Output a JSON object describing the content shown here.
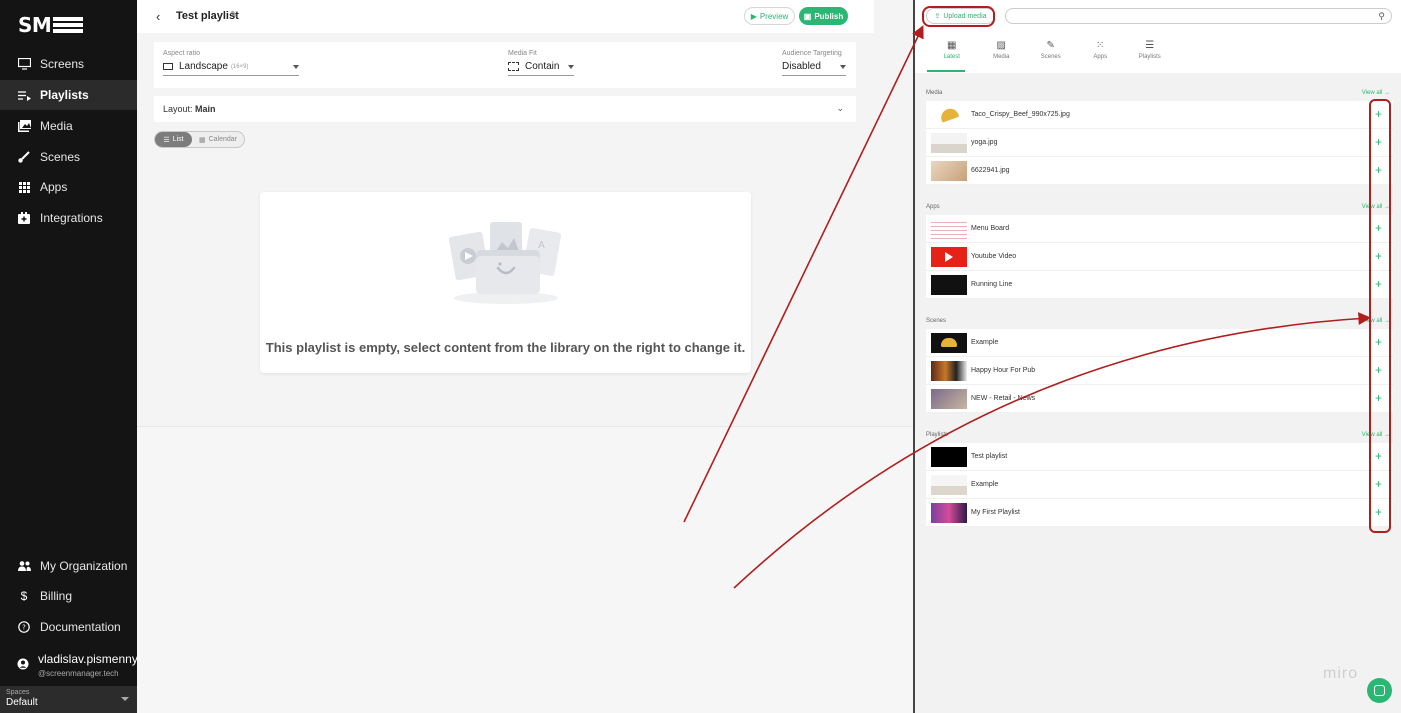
{
  "sidebar": {
    "logo": "SM",
    "items": [
      {
        "label": "Screens"
      },
      {
        "label": "Playlists"
      },
      {
        "label": "Media"
      },
      {
        "label": "Scenes"
      },
      {
        "label": "Apps"
      },
      {
        "label": "Integrations"
      }
    ],
    "bottom_items": [
      {
        "label": "My Organization"
      },
      {
        "label": "Billing"
      },
      {
        "label": "Documentation"
      }
    ],
    "user": {
      "name": "vladislav.pismennyj",
      "email": "@screenmanager.tech"
    },
    "spaces": {
      "label": "Spaces",
      "value": "Default"
    }
  },
  "header": {
    "back": "‹",
    "title": "Test playlist",
    "preview_label": "Preview",
    "publish_label": "Publish"
  },
  "settings": {
    "aspect": {
      "label": "Aspect ratio",
      "value": "Landscape",
      "sub": "(16×9)"
    },
    "fit": {
      "label": "Media Fit",
      "value": "Contain"
    },
    "targeting": {
      "label": "Audience Targeting",
      "value": "Disabled"
    }
  },
  "layout": {
    "prefix": "Layout:",
    "name": "Main"
  },
  "view_toggle": {
    "list": "List",
    "calendar": "Calendar"
  },
  "empty_message": "This playlist is empty, select content from the library on the right to change it.",
  "library": {
    "upload_label": "Upload media",
    "tabs": [
      "Latest",
      "Media",
      "Scenes",
      "Apps",
      "Playlists"
    ],
    "view_all": "View all",
    "sections": [
      {
        "title": "Media",
        "items": [
          "Taco_Crispy_Beef_990x725.jpg",
          "yoga.jpg",
          "6622941.jpg"
        ]
      },
      {
        "title": "Apps",
        "items": [
          "Menu Board",
          "Youtube Video",
          "Running Line"
        ]
      },
      {
        "title": "Scenes",
        "items": [
          "Example",
          "Happy Hour For Pub",
          "NEW - Retail - News"
        ]
      },
      {
        "title": "Playlists",
        "items": [
          "Test playlist",
          "Example",
          "My First Playlist"
        ]
      }
    ]
  },
  "watermark": "miro",
  "colors": {
    "accent": "#2bb673",
    "annotation": "#b01e1e",
    "sidebar": "#141414"
  }
}
